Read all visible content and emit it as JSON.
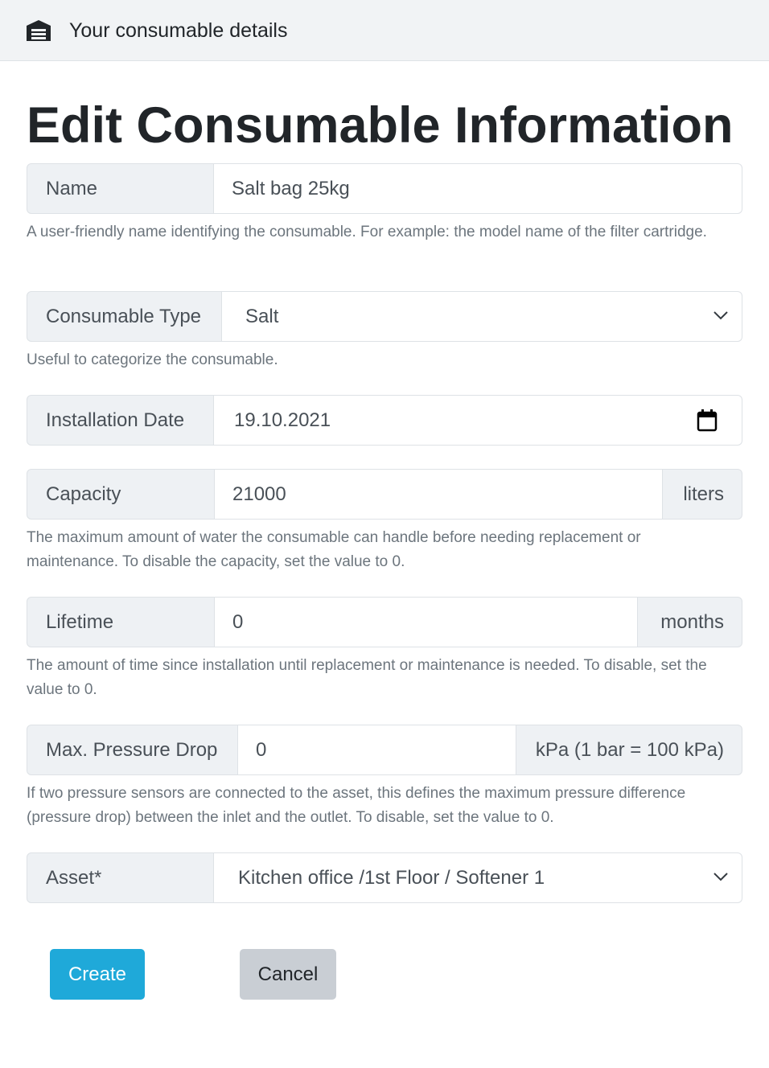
{
  "header": {
    "title": "Your consumable details",
    "logo_icon": "warehouse-icon"
  },
  "page": {
    "title": "Edit Consumable Information"
  },
  "form": {
    "name": {
      "label": "Name",
      "value": "Salt bag 25kg",
      "help": "A user-friendly name identifying the consumable. For example: the model name of the filter cartridge."
    },
    "type": {
      "label": "Consumable Type",
      "value": "Salt",
      "help": "Useful to categorize the consumable."
    },
    "installation_date": {
      "label": "Installation Date",
      "value": "19.10.2021",
      "icon": "calendar-icon"
    },
    "capacity": {
      "label": "Capacity",
      "value": "21000",
      "unit": "liters",
      "help": "The maximum amount of water the consumable can handle before needing replacement or maintenance. To disable the capacity, set the value to 0."
    },
    "lifetime": {
      "label": "Lifetime",
      "value": "0",
      "unit": "months",
      "help": "The amount of time since installation until replacement or maintenance is needed. To disable, set the value to 0."
    },
    "pressure_drop": {
      "label": "Max. Pressure Drop",
      "value": "0",
      "unit": "kPa (1 bar = 100 kPa)",
      "help": "If two pressure sensors are connected to the asset, this defines the maximum pressure difference (pressure drop) between the inlet and the outlet. To disable, set the value to 0."
    },
    "asset": {
      "label": "Asset*",
      "value": "Kitchen office /1st Floor / Softener 1"
    }
  },
  "actions": {
    "create_label": "Create",
    "cancel_label": "Cancel"
  },
  "colors": {
    "primary": "#1fa9d9",
    "secondary": "#c9ced4",
    "addon_bg": "#eef1f4"
  }
}
